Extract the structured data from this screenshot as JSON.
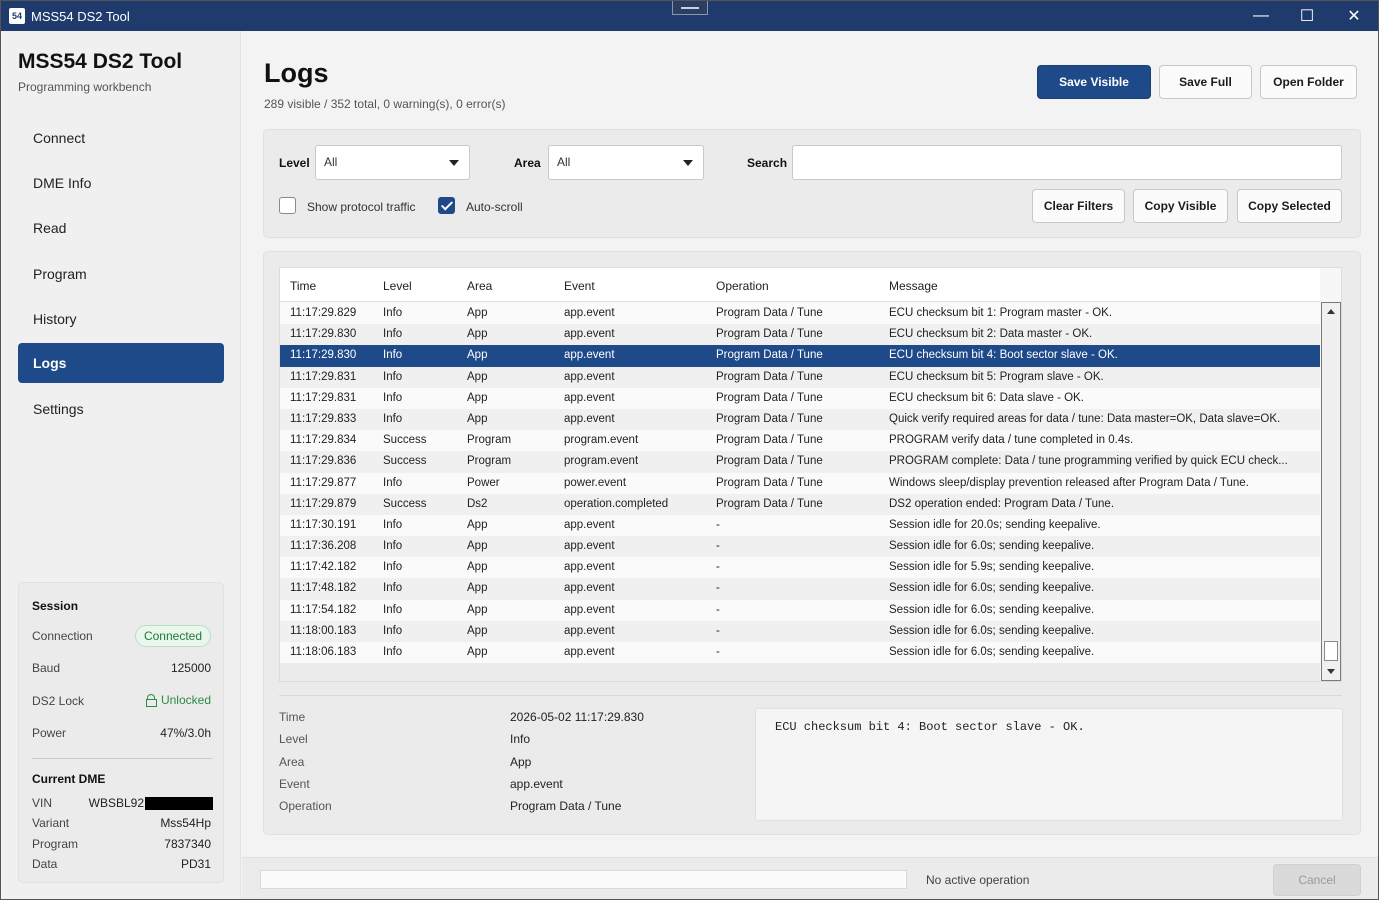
{
  "window": {
    "icon_text": "54",
    "title": "MSS54 DS2 Tool",
    "minimize": "—",
    "maximize": "☐",
    "close": "✕"
  },
  "sidebar": {
    "title": "MSS54 DS2 Tool",
    "subtitle": "Programming workbench",
    "items": [
      {
        "label": "Connect"
      },
      {
        "label": "DME Info"
      },
      {
        "label": "Read"
      },
      {
        "label": "Program"
      },
      {
        "label": "History"
      },
      {
        "label": "Logs"
      },
      {
        "label": "Settings"
      }
    ],
    "active_item": "Logs",
    "session": {
      "title": "Session",
      "connection_label": "Connection",
      "connection_value": "Connected",
      "baud_label": "Baud",
      "baud_value": "125000",
      "lock_label": "DS2 Lock",
      "lock_value": "Unlocked",
      "power_label": "Power",
      "power_value": "47%/3.0h"
    },
    "dme": {
      "title": "Current DME",
      "vin_label": "VIN",
      "vin_value": "WBSBL92",
      "variant_label": "Variant",
      "variant_value": "Mss54Hp",
      "program_label": "Program",
      "program_value": "7837340",
      "data_label": "Data",
      "data_value": "PD31"
    }
  },
  "header": {
    "title": "Logs",
    "summary": "289 visible / 352 total, 0 warning(s), 0 error(s)",
    "save_visible": "Save Visible",
    "save_full": "Save Full",
    "open_folder": "Open Folder"
  },
  "filters": {
    "level_label": "Level",
    "level_value": "All",
    "area_label": "Area",
    "area_value": "All",
    "search_label": "Search",
    "search_value": "",
    "show_protocol_label": "Show protocol traffic",
    "show_protocol_checked": false,
    "autoscroll_label": "Auto-scroll",
    "autoscroll_checked": true,
    "clear_filters": "Clear Filters",
    "copy_visible": "Copy Visible",
    "copy_selected": "Copy Selected"
  },
  "grid": {
    "columns": [
      "Time",
      "Level",
      "Area",
      "Event",
      "Operation",
      "Message"
    ],
    "selected_index": 2,
    "rows": [
      [
        "11:17:29.829",
        "Info",
        "App",
        "app.event",
        "Program Data / Tune",
        "ECU checksum bit 1: Program master - OK."
      ],
      [
        "11:17:29.830",
        "Info",
        "App",
        "app.event",
        "Program Data / Tune",
        "ECU checksum bit 2: Data master - OK."
      ],
      [
        "11:17:29.830",
        "Info",
        "App",
        "app.event",
        "Program Data / Tune",
        "ECU checksum bit 4: Boot sector slave - OK."
      ],
      [
        "11:17:29.831",
        "Info",
        "App",
        "app.event",
        "Program Data / Tune",
        "ECU checksum bit 5: Program slave - OK."
      ],
      [
        "11:17:29.831",
        "Info",
        "App",
        "app.event",
        "Program Data / Tune",
        "ECU checksum bit 6: Data slave - OK."
      ],
      [
        "11:17:29.833",
        "Info",
        "App",
        "app.event",
        "Program Data / Tune",
        "Quick verify required areas for data / tune: Data master=OK, Data slave=OK."
      ],
      [
        "11:17:29.834",
        "Success",
        "Program",
        "program.event",
        "Program Data / Tune",
        "PROGRAM verify data / tune completed in 0.4s."
      ],
      [
        "11:17:29.836",
        "Success",
        "Program",
        "program.event",
        "Program Data / Tune",
        "PROGRAM complete: Data / tune programming verified by quick ECU check..."
      ],
      [
        "11:17:29.877",
        "Info",
        "Power",
        "power.event",
        "Program Data / Tune",
        "Windows sleep/display prevention released after Program Data / Tune."
      ],
      [
        "11:17:29.879",
        "Success",
        "Ds2",
        "operation.completed",
        "Program Data / Tune",
        "DS2 operation ended: Program Data / Tune."
      ],
      [
        "11:17:30.191",
        "Info",
        "App",
        "app.event",
        "-",
        "Session idle for 20.0s; sending keepalive."
      ],
      [
        "11:17:36.208",
        "Info",
        "App",
        "app.event",
        "-",
        "Session idle for 6.0s; sending keepalive."
      ],
      [
        "11:17:42.182",
        "Info",
        "App",
        "app.event",
        "-",
        "Session idle for 5.9s; sending keepalive."
      ],
      [
        "11:17:48.182",
        "Info",
        "App",
        "app.event",
        "-",
        "Session idle for 6.0s; sending keepalive."
      ],
      [
        "11:17:54.182",
        "Info",
        "App",
        "app.event",
        "-",
        "Session idle for 6.0s; sending keepalive."
      ],
      [
        "11:18:00.183",
        "Info",
        "App",
        "app.event",
        "-",
        "Session idle for 6.0s; sending keepalive."
      ],
      [
        "11:18:06.183",
        "Info",
        "App",
        "app.event",
        "-",
        "Session idle for 6.0s; sending keepalive."
      ]
    ]
  },
  "detail": {
    "time_label": "Time",
    "time_value": "2026-05-02 11:17:29.830",
    "level_label": "Level",
    "level_value": "Info",
    "area_label": "Area",
    "area_value": "App",
    "event_label": "Event",
    "event_value": "app.event",
    "operation_label": "Operation",
    "operation_value": "Program Data / Tune",
    "message": "ECU checksum bit 4: Boot sector slave - OK."
  },
  "footer": {
    "status": "No active operation",
    "cancel": "Cancel",
    "progress": 0
  },
  "colors": {
    "accent": "#1f4a8a",
    "titlebar": "#1f3b6e",
    "success": "#1f7a3a"
  }
}
